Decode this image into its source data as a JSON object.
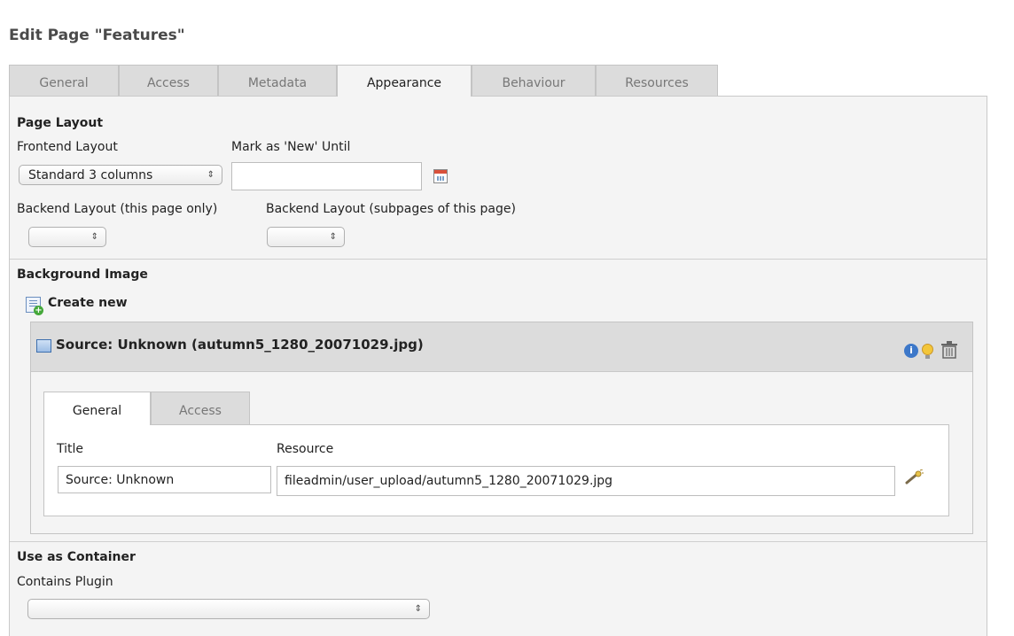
{
  "page": {
    "title": "Edit Page \"Features\""
  },
  "tabs": [
    {
      "label": "General"
    },
    {
      "label": "Access"
    },
    {
      "label": "Metadata"
    },
    {
      "label": "Appearance"
    },
    {
      "label": "Behaviour"
    },
    {
      "label": "Resources"
    }
  ],
  "active_tab": "Appearance",
  "page_layout": {
    "heading": "Page Layout",
    "frontend_layout": {
      "label": "Frontend Layout",
      "value": "Standard 3 columns"
    },
    "mark_new": {
      "label": "Mark as 'New' Until",
      "value": ""
    },
    "backend_layout_page": {
      "label": "Backend Layout (this page only)",
      "value": ""
    },
    "backend_layout_sub": {
      "label": "Backend Layout (subpages of this page)",
      "value": ""
    }
  },
  "background_image": {
    "heading": "Background Image",
    "create_new": "Create new",
    "record": {
      "title": "Source: Unknown (autumn5_1280_20071029.jpg)",
      "tabs": [
        {
          "label": "General"
        },
        {
          "label": "Access"
        }
      ],
      "title_field": {
        "label": "Title",
        "value": "Source: Unknown"
      },
      "resource_field": {
        "label": "Resource",
        "value": "fileadmin/user_upload/autumn5_1280_20071029.jpg"
      }
    }
  },
  "container": {
    "heading": "Use as Container",
    "contains_plugin": {
      "label": "Contains Plugin",
      "value": ""
    }
  },
  "select_arrows": "⇕",
  "icons": {
    "calendar": "calendar-icon",
    "create": "create-new-icon",
    "record": "record-icon",
    "info": "info-icon",
    "bulb": "bulb-icon",
    "trash": "trash-icon",
    "wand": "wand-icon"
  }
}
